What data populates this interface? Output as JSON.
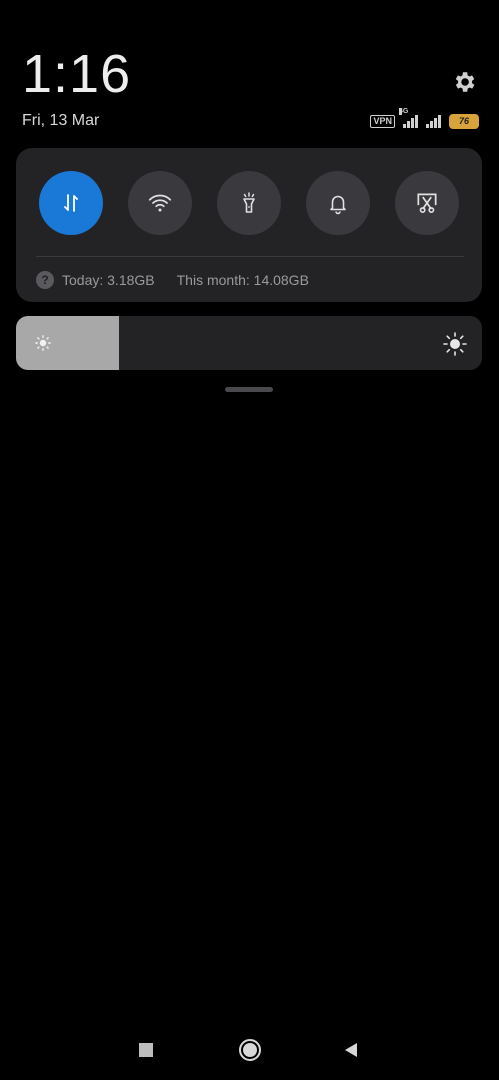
{
  "header": {
    "time": "1:16",
    "date": "Fri, 13 Mar"
  },
  "status": {
    "vpn_label": "VPN",
    "network_type": "4G",
    "battery_level": "76"
  },
  "toggles": [
    {
      "name": "mobile-data",
      "icon": "data-arrows-icon",
      "active": true
    },
    {
      "name": "wifi",
      "icon": "wifi-icon",
      "active": false
    },
    {
      "name": "flashlight",
      "icon": "flashlight-icon",
      "active": false
    },
    {
      "name": "sound",
      "icon": "bell-icon",
      "active": false
    },
    {
      "name": "screenshot",
      "icon": "scissors-icon",
      "active": false
    }
  ],
  "usage": {
    "today": "Today: 3.18GB",
    "month": "This month: 14.08GB"
  },
  "brightness": {
    "level_fraction": 0.22
  },
  "colors": {
    "accent": "#1a78d6",
    "card": "#232326",
    "battery": "#d8a33a"
  }
}
